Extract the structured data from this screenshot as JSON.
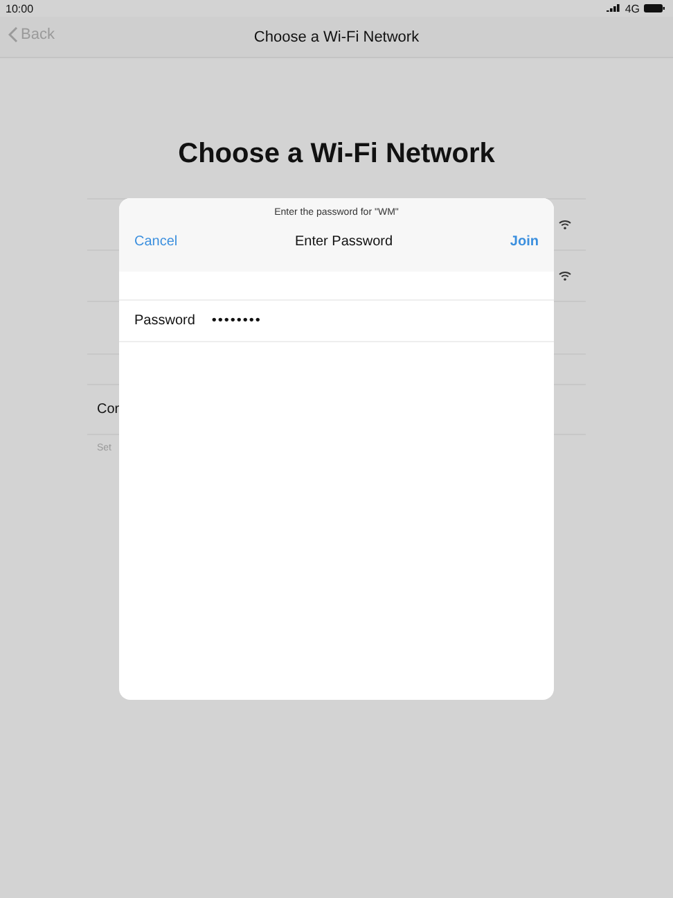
{
  "status_bar": {
    "time": "10:00",
    "network": "4G"
  },
  "nav": {
    "back": "Back",
    "title": "Choose a Wi-Fi Network"
  },
  "heading": "Choose a Wi-Fi Network",
  "background_rows": [
    {
      "kind": "network"
    },
    {
      "kind": "network"
    },
    {
      "kind": "blank"
    },
    {
      "kind": "gap"
    },
    {
      "kind": "text",
      "label": "Cor"
    }
  ],
  "background_footer": "Set",
  "dialog": {
    "prompt": "Enter the password for \"WM\"",
    "cancel": "Cancel",
    "title": "Enter Password",
    "join": "Join",
    "field": {
      "label": "Password",
      "value": "••••••••"
    }
  }
}
